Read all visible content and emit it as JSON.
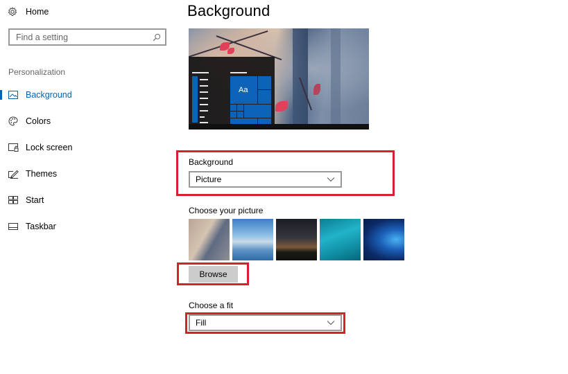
{
  "sidebar": {
    "home_label": "Home",
    "search_placeholder": "Find a setting",
    "section_label": "Personalization",
    "items": [
      {
        "label": "Background",
        "icon": "picture-icon",
        "active": true
      },
      {
        "label": "Colors",
        "icon": "palette-icon",
        "active": false
      },
      {
        "label": "Lock screen",
        "icon": "lock-screen-icon",
        "active": false
      },
      {
        "label": "Themes",
        "icon": "themes-icon",
        "active": false
      },
      {
        "label": "Start",
        "icon": "start-icon",
        "active": false
      },
      {
        "label": "Taskbar",
        "icon": "taskbar-icon",
        "active": false
      }
    ]
  },
  "main": {
    "title": "Background",
    "preview": {
      "tile_text": "Aa"
    },
    "background_field": {
      "label": "Background",
      "value": "Picture"
    },
    "choose_picture": {
      "label": "Choose your picture",
      "thumbnails": [
        "autumn-leaves",
        "beach-rocks",
        "night-sky-tent",
        "underwater-swimmer",
        "windows-logo"
      ]
    },
    "browse_label": "Browse",
    "fit_field": {
      "label": "Choose a fit",
      "value": "Fill"
    }
  },
  "colors": {
    "accent": "#0063b1",
    "highlight_box": "#d7202d",
    "tile_blue": "#0d63b8"
  }
}
